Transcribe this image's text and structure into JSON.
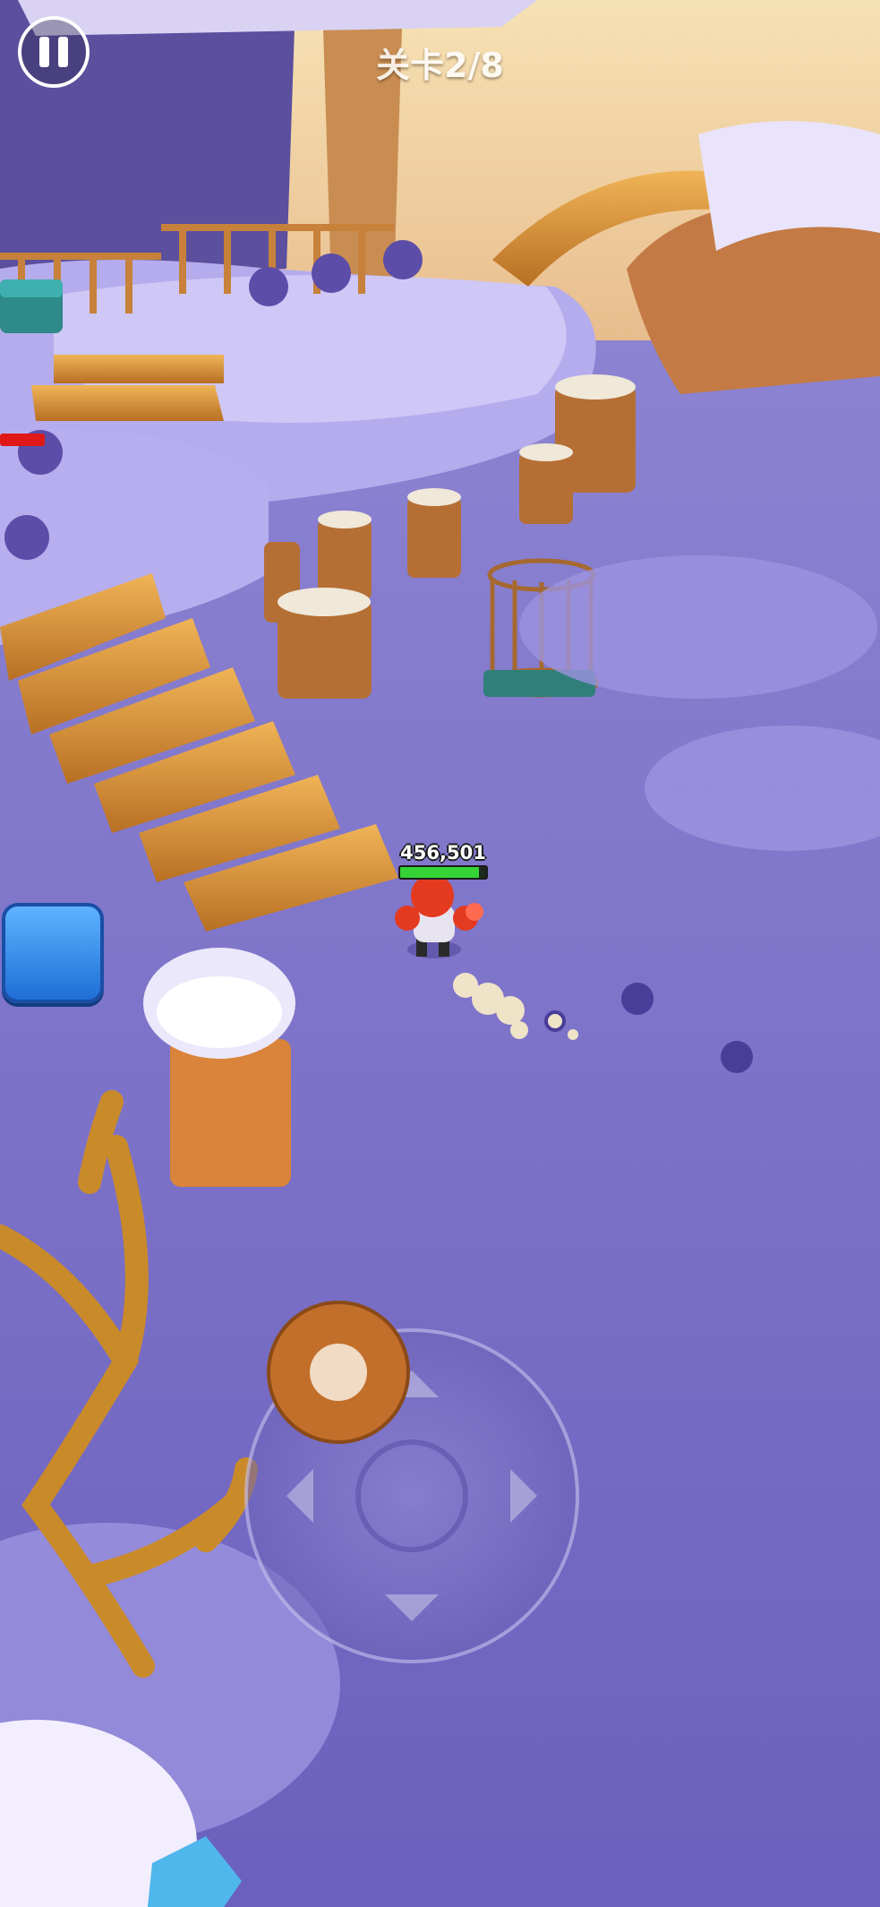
{
  "hud": {
    "level_label": "关卡2/8",
    "pause_icon": "pause-icon",
    "player_hp_text": "456,501",
    "player_hp_fraction": 0.92,
    "enemy_hp_fraction": 1.0
  },
  "joystick": {
    "arrows": [
      "up",
      "down",
      "left",
      "right"
    ]
  },
  "colors": {
    "snow": "#f1eefc",
    "ground_purple": "#7d73c9",
    "wood": "#d9933a",
    "hp_green": "#35d335",
    "enemy_red": "#e01818",
    "skill_blue": "#2f8bf0"
  }
}
